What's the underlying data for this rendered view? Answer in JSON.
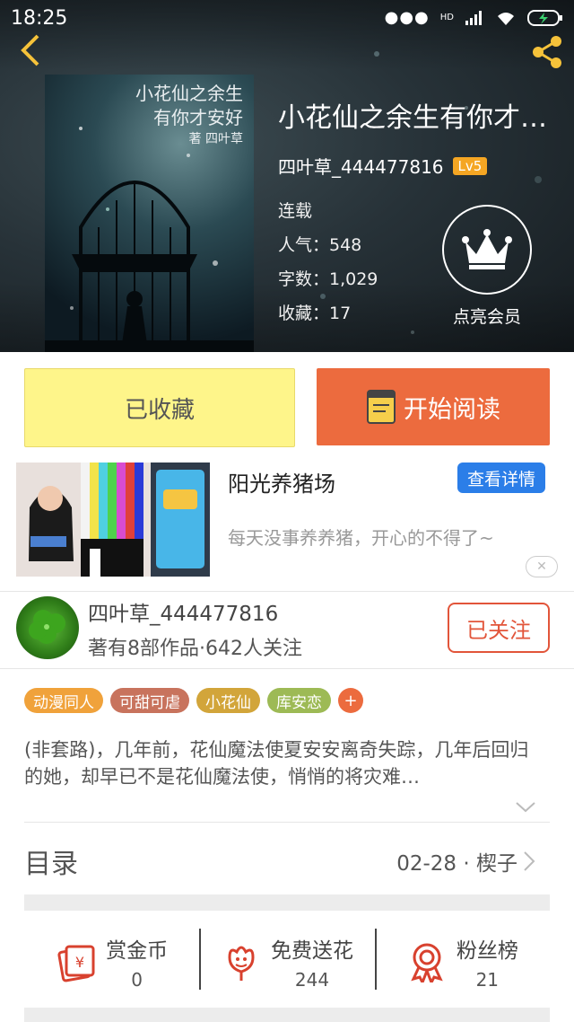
{
  "status_bar": {
    "time": "18:25",
    "network_label": "HD"
  },
  "book": {
    "title": "小花仙之余生有你才…",
    "cover_lines": [
      "小花仙之余生",
      "有你才安好",
      "著 四叶草"
    ],
    "author": "四叶草_444477816",
    "level": "Lv5",
    "status": "连载",
    "popularity_label": "人气：548",
    "word_count_label": "字数：1,029",
    "favorites_label": "收藏：17"
  },
  "vip": {
    "label": "点亮会员"
  },
  "actions": {
    "favorited_label": "已收藏",
    "read_label": "开始阅读"
  },
  "ad": {
    "title": "阳光养猪场",
    "detail_button": "查看详情",
    "description": "每天没事养养猪，开心的不得了~",
    "close_icon": "close-icon"
  },
  "author_card": {
    "name": "四叶草_444477816",
    "summary": "著有8部作品·642人关注",
    "follow_label": "已关注"
  },
  "tags": [
    {
      "label": "动漫同人",
      "color": "#f0a23b"
    },
    {
      "label": "可甜可虐",
      "color": "#c8735d"
    },
    {
      "label": "小花仙",
      "color": "#d2a53a"
    },
    {
      "label": "库安恋",
      "color": "#9dba55"
    }
  ],
  "synopsis": "(非套路)，几年前，花仙魔法使夏安安离奇失踪，几年后回归的她，却早已不是花仙魔法使，悄悄的将灾难…",
  "toc": {
    "title": "目录",
    "latest": "02-28 · 楔子"
  },
  "rewards": [
    {
      "label": "赏金币",
      "value": "0",
      "icon": "reward-coin-icon"
    },
    {
      "label": "免费送花",
      "value": "244",
      "icon": "flower-icon"
    },
    {
      "label": "粉丝榜",
      "value": "21",
      "icon": "medal-icon"
    }
  ],
  "colors": {
    "accent_orange": "#ec6b3e",
    "favorite_yellow": "#fef58a",
    "ad_blue": "#2b7ee8",
    "follow_red": "#e2553a"
  }
}
